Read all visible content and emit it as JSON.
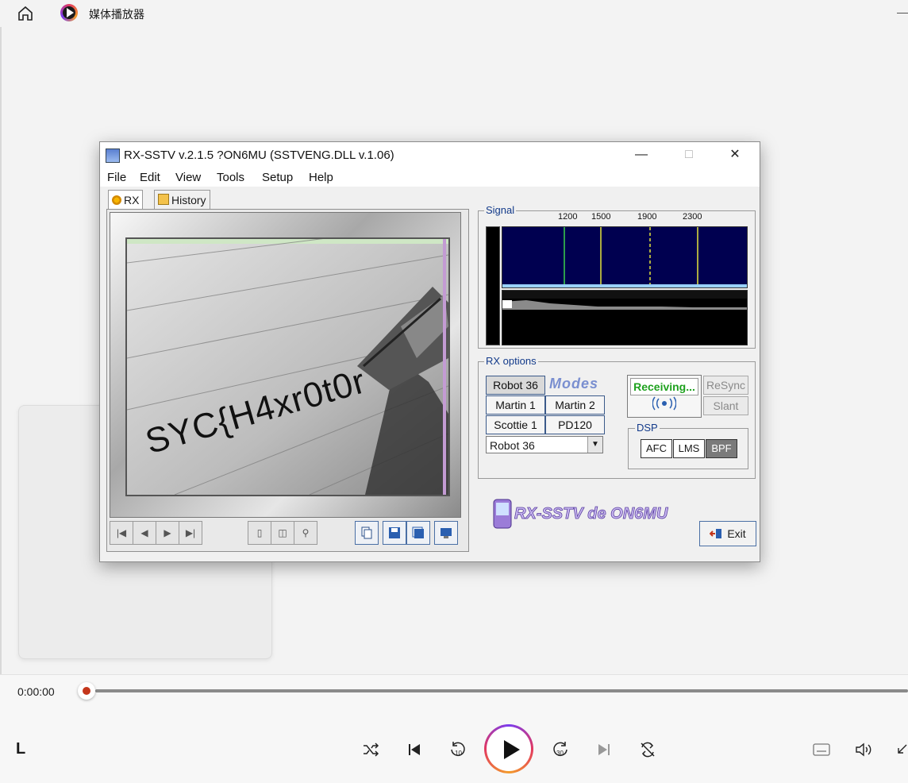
{
  "player": {
    "title": "媒体播放器",
    "time": "0:00:00",
    "now_playing_initial": "L",
    "accent": "#c4361b",
    "controls": [
      "shuffle-icon",
      "previous-icon",
      "rewind-10-icon",
      "play-icon",
      "forward-30-icon",
      "next-icon",
      "repeat-icon",
      "captions-icon",
      "volume-icon"
    ]
  },
  "rxsstv": {
    "title": "RX-SSTV v.2.1.5 ?ON6MU (SSTVENG.DLL v.1.06)",
    "menu": [
      "File",
      "Edit",
      "View",
      "Tools",
      "Setup",
      "Help"
    ],
    "tabs": [
      "RX",
      "History"
    ],
    "image_text": "SYC{H4xr0t0r",
    "signal": {
      "label": "Signal",
      "freqs": [
        "1200",
        "1500",
        "1900",
        "2300"
      ]
    },
    "rx_options": {
      "label": "RX options",
      "modes_logo": "Modes",
      "modes": [
        "Robot 36",
        "Martin 1",
        "Martin 2",
        "Scottie 1",
        "PD120"
      ],
      "selected_mode": "Robot 36",
      "dropdown_value": "Robot 36",
      "status": "Receiving...",
      "resync": "ReSync",
      "slant": "Slant",
      "dsp_label": "DSP",
      "dsp": [
        "AFC",
        "LMS",
        "BPF"
      ]
    },
    "brand": "RX-SSTV de ON6MU",
    "exit": "Exit"
  }
}
